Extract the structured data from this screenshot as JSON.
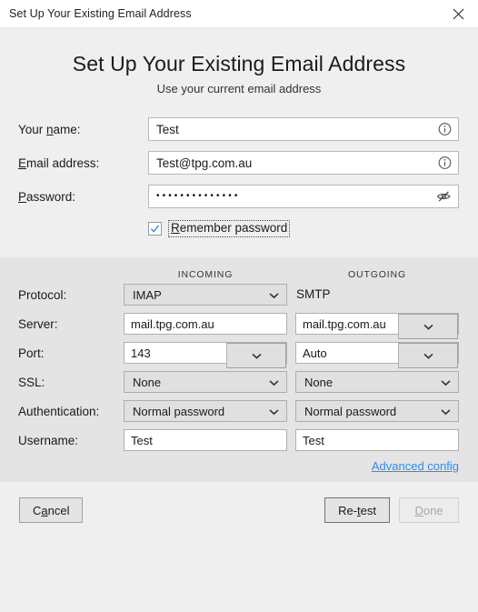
{
  "window": {
    "title": "Set Up Your Existing Email Address",
    "close_icon": "close-icon"
  },
  "header": {
    "title": "Set Up Your Existing Email Address",
    "subtitle": "Use your current email address"
  },
  "account": {
    "name": {
      "label_pre": "Your ",
      "label_key": "n",
      "label_post": "ame:",
      "value": "Test",
      "icon": "info-icon"
    },
    "email": {
      "label_key": "E",
      "label_post": "mail address:",
      "value": "Test@tpg.com.au",
      "icon": "info-icon"
    },
    "password": {
      "label_key": "P",
      "label_post": "assword:",
      "value": "••••••••••••••",
      "icon": "eye-off-icon"
    },
    "remember": {
      "label_key": "R",
      "label_post": "emember password",
      "checked": true
    }
  },
  "columns": {
    "incoming": "INCOMING",
    "outgoing": "OUTGOING"
  },
  "settings": {
    "rows": [
      {
        "label": "Protocol:",
        "incoming": {
          "type": "select",
          "value": "IMAP"
        },
        "outgoing": {
          "type": "text",
          "value": "SMTP"
        }
      },
      {
        "label": "Server:",
        "incoming": {
          "type": "input",
          "value": "mail.tpg.com.au"
        },
        "outgoing": {
          "type": "combo",
          "value": "mail.tpg.com.au"
        }
      },
      {
        "label": "Port:",
        "incoming": {
          "type": "combo",
          "value": "143"
        },
        "outgoing": {
          "type": "combo",
          "value": "Auto"
        }
      },
      {
        "label": "SSL:",
        "incoming": {
          "type": "select",
          "value": "None"
        },
        "outgoing": {
          "type": "select",
          "value": "None"
        }
      },
      {
        "label": "Authentication:",
        "incoming": {
          "type": "select",
          "value": "Normal password"
        },
        "outgoing": {
          "type": "select",
          "value": "Normal password"
        }
      },
      {
        "label": "Username:",
        "incoming": {
          "type": "input",
          "value": "Test"
        },
        "outgoing": {
          "type": "input",
          "value": "Test"
        }
      }
    ],
    "advanced_link": {
      "key": "A",
      "rest": "dvanced config"
    }
  },
  "footer": {
    "cancel": {
      "pre": "C",
      "key": "a",
      "post": "ncel"
    },
    "retest": {
      "pre": "Re-",
      "key": "t",
      "post": "est"
    },
    "done": {
      "key": "D",
      "post": "one",
      "disabled": true
    }
  },
  "colors": {
    "link": "#2a8ef9",
    "check": "#3b8fe8",
    "pane_top_bg": "#efefef",
    "pane_mid_bg": "#e4e4e4",
    "titlebar_bg": "#ffffff"
  }
}
